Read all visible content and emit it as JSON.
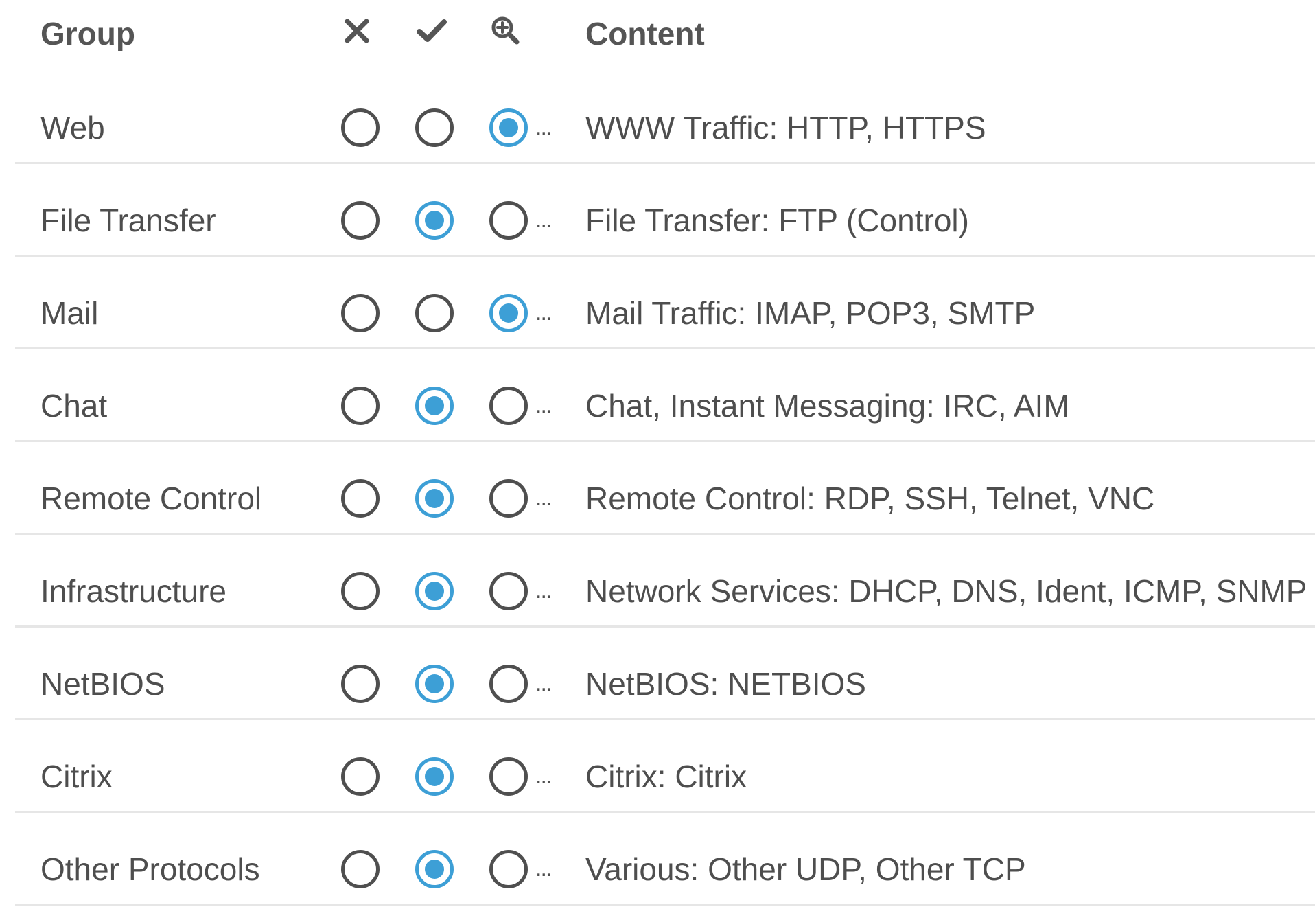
{
  "header": {
    "group_label": "Group",
    "content_label": "Content",
    "icons": [
      "block-icon",
      "allow-icon",
      "inspect-icon"
    ]
  },
  "colors": {
    "checked": "#3d9fd6",
    "unchecked_border": "#4f4f4f",
    "divider": "#e6e6e6",
    "text": "#4e4e4e"
  },
  "rows": [
    {
      "group": "Web",
      "selected": "inspect",
      "ellipsis": "...",
      "content": "WWW Traffic: HTTP, HTTPS"
    },
    {
      "group": "File Transfer",
      "selected": "allow",
      "ellipsis": "...",
      "content": "File Transfer: FTP (Control)"
    },
    {
      "group": "Mail",
      "selected": "inspect",
      "ellipsis": "...",
      "content": "Mail Traffic: IMAP, POP3, SMTP"
    },
    {
      "group": "Chat",
      "selected": "allow",
      "ellipsis": "...",
      "content": "Chat, Instant Messaging: IRC, AIM"
    },
    {
      "group": "Remote Control",
      "selected": "allow",
      "ellipsis": "...",
      "content": "Remote Control: RDP, SSH, Telnet, VNC"
    },
    {
      "group": "Infrastructure",
      "selected": "allow",
      "ellipsis": "...",
      "content": "Network Services: DHCP, DNS, Ident, ICMP, SNMP"
    },
    {
      "group": "NetBIOS",
      "selected": "allow",
      "ellipsis": "...",
      "content": "NetBIOS: NETBIOS"
    },
    {
      "group": "Citrix",
      "selected": "allow",
      "ellipsis": "...",
      "content": "Citrix: Citrix"
    },
    {
      "group": "Other Protocols",
      "selected": "allow",
      "ellipsis": "...",
      "content": "Various: Other UDP, Other TCP"
    }
  ]
}
